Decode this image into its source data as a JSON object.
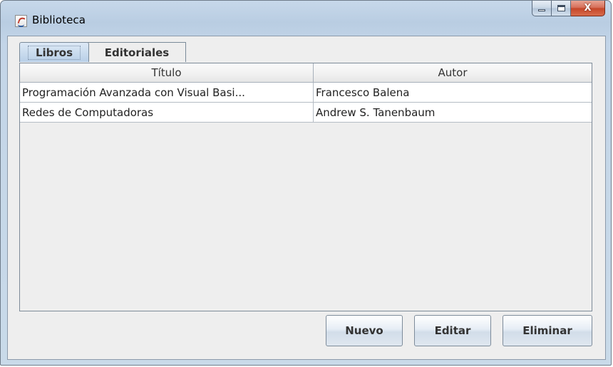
{
  "window": {
    "title": "Biblioteca",
    "icon": "java-cup-icon",
    "controls": {
      "minimize": "minimize-icon",
      "maximize": "maximize-icon",
      "close": "X"
    }
  },
  "tabs": [
    {
      "label": "Libros",
      "selected": true
    },
    {
      "label": "Editoriales",
      "selected": false
    }
  ],
  "table": {
    "columns": [
      "Título",
      "Autor"
    ],
    "rows": [
      [
        "Programación Avanzada con Visual Basi...",
        "Francesco Balena"
      ],
      [
        "Redes de Computadoras",
        "Andrew S. Tanenbaum"
      ]
    ]
  },
  "buttons": {
    "nuevo": "Nuevo",
    "editar": "Editar",
    "eliminar": "Eliminar"
  }
}
